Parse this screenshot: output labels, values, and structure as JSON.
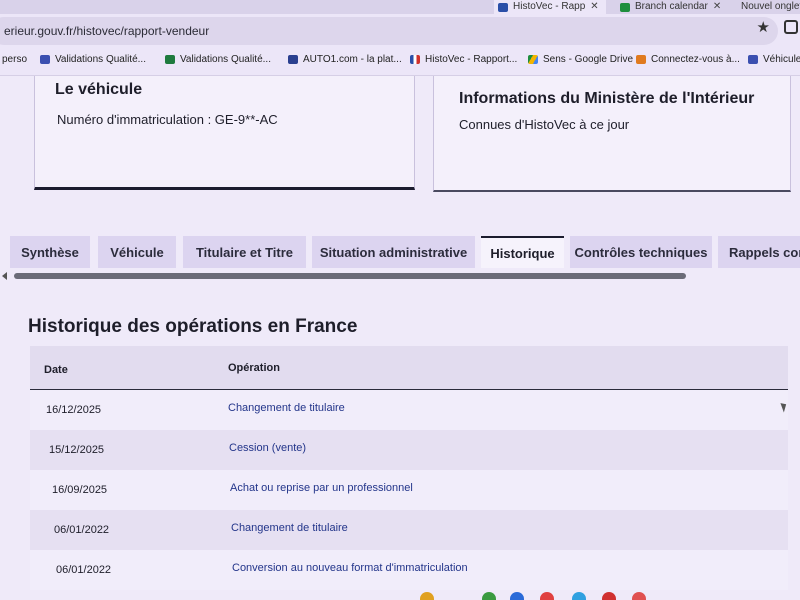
{
  "browser": {
    "tabs": [
      {
        "label": "HistoVec - Rapp",
        "active": true
      },
      {
        "label": "Branch calendar",
        "active": false
      },
      {
        "label": "Nouvel onglet",
        "active": false
      }
    ],
    "url": "erieur.gouv.fr/histovec/rapport-vendeur",
    "bookmarks": [
      {
        "label": "perso"
      },
      {
        "label": "Validations Qualité..."
      },
      {
        "label": "Validations Qualité..."
      },
      {
        "label": "AUTO1.com - la plat..."
      },
      {
        "label": "HistoVec - Rapport..."
      },
      {
        "label": "Sens - Google Drive"
      },
      {
        "label": "Connectez-vous à..."
      },
      {
        "label": "Véhicules"
      }
    ]
  },
  "vehicle_card": {
    "title": "Le véhicule",
    "registration": "Numéro d'immatriculation : GE-9**-AC"
  },
  "ministry_card": {
    "title": "Informations du Ministère de l'Intérieur",
    "subtitle": "Connues d'HistoVec à ce jour"
  },
  "report_tabs": [
    {
      "label": "Synthèse",
      "active": false
    },
    {
      "label": "Véhicule",
      "active": false
    },
    {
      "label": "Titulaire et Titre",
      "active": false
    },
    {
      "label": "Situation administrative",
      "active": false
    },
    {
      "label": "Historique",
      "active": true
    },
    {
      "label": "Contrôles techniques",
      "active": false
    },
    {
      "label": "Rappels cons",
      "active": false
    }
  ],
  "history": {
    "title": "Historique des opérations en France",
    "columns": {
      "date": "Date",
      "operation": "Opération"
    },
    "rows": [
      {
        "date": "16/12/2025",
        "operation": "Changement de titulaire"
      },
      {
        "date": "15/12/2025",
        "operation": "Cession (vente)"
      },
      {
        "date": "16/09/2025",
        "operation": "Achat ou reprise par un professionnel"
      },
      {
        "date": "06/01/2022",
        "operation": "Changement de titulaire"
      },
      {
        "date": "06/01/2022",
        "operation": "Conversion au nouveau format d'immatriculation"
      }
    ]
  },
  "colors": {
    "page_bg": "#efeaf9",
    "tab_bg": "#dcd4f0",
    "link": "#23358a",
    "accent_dark": "#1b1b2e"
  }
}
